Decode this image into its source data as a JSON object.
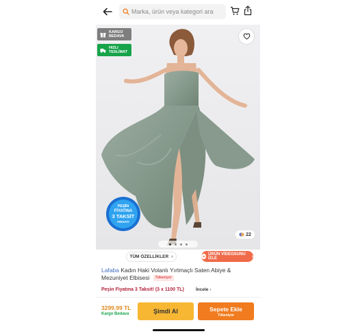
{
  "header": {
    "search_placeholder": "Marka, ürün veya kategori ara",
    "icons": [
      "arrow-left-icon",
      "search-icon",
      "cart-icon",
      "share-icon"
    ]
  },
  "hero": {
    "badges": [
      {
        "label_line1": "KARGO",
        "label_line2": "BEDAVA",
        "color": "#7e7e7e",
        "icon": "gift-icon"
      },
      {
        "label_line1": "HIZLI",
        "label_line2": "TESLİMAT",
        "color": "#17a34a",
        "icon": "truck-icon"
      }
    ],
    "promo": {
      "line1": "PEŞİN",
      "line2": "FİYATINA",
      "line3": "3 TAKSİT",
      "line4": "FIRSATI"
    },
    "image_count": "22",
    "pager_total": 4,
    "pager_active": 1,
    "dress_color": "#8fa094"
  },
  "chips": {
    "all_features": "TÜM ÖZELLİKLER",
    "watch_video": "ÜRÜN VİDEOSUNU İZLE"
  },
  "product": {
    "brand": "Lafaba",
    "name": "Kadın Haki Volanlı Yırtmaçlı Saten Abiye & Mezuniyet Elbisesi",
    "stock_tag": "Tükeniyor",
    "installment": "Peşin Fiyatına 3 Taksit! (3 x 1100 TL)",
    "review_link": "İncele"
  },
  "bottom_bar": {
    "price": "3299.99 TL",
    "shipping": "Kargo Bedava",
    "buy_now": "Şimdi Al",
    "add_to_cart": "Sepete Ekle",
    "add_to_cart_sub": "Tükeniyor"
  },
  "colors": {
    "accent_orange": "#f07c1f",
    "buy_yellow": "#f7b733",
    "brand_blue": "#3d6cc2",
    "installment_red": "#b2233b",
    "green": "#17a34a"
  }
}
